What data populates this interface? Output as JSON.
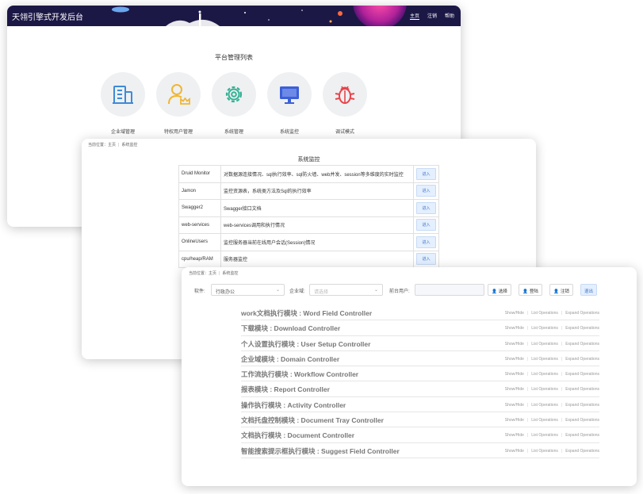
{
  "card1": {
    "app_title": "天翎引擎式开发后台",
    "nav": [
      "主页",
      "注销",
      "帮助"
    ],
    "heading": "平台管理列表",
    "tiles": [
      {
        "label": "企业域管理",
        "icon": "building-icon",
        "color": "#3d8bd8"
      },
      {
        "label": "特权用户管理",
        "icon": "crowned-user-icon",
        "color": "#f0b634"
      },
      {
        "label": "系统管理",
        "icon": "gear-icon",
        "color": "#35b195"
      },
      {
        "label": "系统监控",
        "icon": "monitor-icon",
        "color": "#3c60d8"
      },
      {
        "label": "调试模式",
        "icon": "bug-icon",
        "color": "#e8454b"
      }
    ]
  },
  "card2": {
    "breadcrumb": {
      "prefix": "当前位置：",
      "home": "主页",
      "current": "系统监控"
    },
    "title": "系统监控",
    "button_label": "进入",
    "rows": [
      {
        "name": "Druid Monitor",
        "desc": "对数据源连接情况、sql执行效率、sql防火墙、web并发、session等多维度的实时监控"
      },
      {
        "name": "Jamon",
        "desc": "监控资源表，系统类方法及Sql的执行效率"
      },
      {
        "name": "Swagger2",
        "desc": "Swagger接口文档"
      },
      {
        "name": "web-services",
        "desc": "web-services调用和执行情况"
      },
      {
        "name": "OnlineUsers",
        "desc": "监控服务器当前在线用户会话(Session)情况"
      },
      {
        "name": "cpu/heap/RAM",
        "desc": "服务器监控"
      }
    ]
  },
  "card3": {
    "breadcrumb": {
      "prefix": "当前位置：",
      "home": "主页",
      "current": "系统监控"
    },
    "filters": {
      "software_label": "软件:",
      "software_value": "行政办公",
      "domain_label": "企业域:",
      "domain_placeholder": "请选择",
      "user_label": "前台用户:",
      "btn_select": "选择",
      "btn_login": "登陆",
      "btn_logout": "注销",
      "btn_exit": "退出"
    },
    "ops": [
      "Show/Hide",
      "List Operations",
      "Expand Operations"
    ],
    "controllers": [
      "work文档执行模块 : Word Field Controller",
      "下载模块 : Download Controller",
      "个人设置执行模块 : User Setup Controller",
      "企业域模块 : Domain Controller",
      "工作流执行模块 : Workflow Controller",
      "报表模块 : Report Controller",
      "操作执行模块 : Activity Controller",
      "文档托盘控制模块 : Document Tray Controller",
      "文档执行模块 : Document Controller",
      "智能搜索提示框执行模块 : Suggest Field Controller"
    ]
  }
}
